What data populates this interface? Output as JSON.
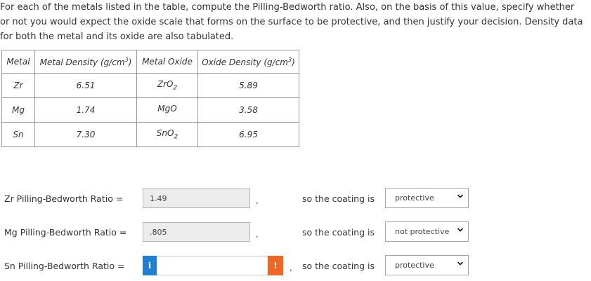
{
  "intro": "For each of the metals listed in the table, compute the Pilling-Bedworth ratio. Also, on the basis of this value, specify whether or not you would expect the oxide scale that forms on the surface to be protective, and then justify your decision. Density data for both the metal and its oxide are also tabulated.",
  "table": {
    "headers": {
      "metal": "Metal",
      "metal_density": "Metal Density (g/cm",
      "metal_oxide": "Metal Oxide",
      "oxide_density": "Oxide Density (g/cm",
      "unit_exp": "3",
      "unit_close": ")"
    },
    "rows": [
      {
        "metal": "Zr",
        "density": "6.51",
        "oxide_base": "ZrO",
        "oxide_sub": "2",
        "oxide_density": "5.89"
      },
      {
        "metal": "Mg",
        "density": "1.74",
        "oxide_base": "MgO",
        "oxide_sub": "",
        "oxide_density": "3.58"
      },
      {
        "metal": "Sn",
        "density": "7.30",
        "oxide_base": "SnO",
        "oxide_sub": "2",
        "oxide_density": "6.95"
      }
    ]
  },
  "answers": [
    {
      "label": "Zr Pilling-Bedworth Ratio =",
      "value": "1.49",
      "coating_text": "so the coating is",
      "selected": "protective"
    },
    {
      "label": "Mg Pilling-Bedworth Ratio =",
      "value": ".805",
      "coating_text": "so the coating is",
      "selected": "not protective"
    },
    {
      "label": "Sn Pilling-Bedworth Ratio =",
      "value": "",
      "info_icon": "i",
      "warn_icon": "!",
      "coating_text": "so the coating is",
      "selected": "protective"
    }
  ],
  "separator": ",",
  "colors": {
    "info": "#1f7fd6",
    "warning": "#f26522"
  },
  "icons": {
    "info": "info-icon",
    "warning": "warning-icon",
    "dropdown": "chevron-down-icon"
  }
}
